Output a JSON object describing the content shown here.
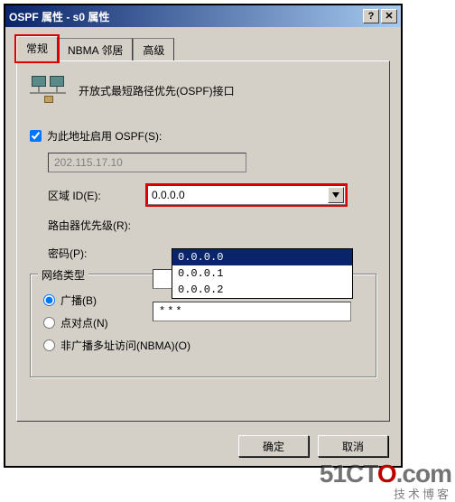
{
  "title": "OSPF 属性 - s0 属性",
  "tabs": {
    "general": "常规",
    "nbma": "NBMA 邻居",
    "advanced": "高级"
  },
  "header": "开放式最短路径优先(OSPF)接口",
  "enable_label": "为此地址启用 OSPF(S):",
  "enable_checked": true,
  "ip_value": "202.115.17.10",
  "area_label": "区域 ID(E):",
  "area_value": "0.0.0.0",
  "area_options": [
    "0.0.0.0",
    "0.0.0.1",
    "0.0.0.2"
  ],
  "priority_label": "路由器优先级(R):",
  "priority_value": "",
  "password_label": "密码(P):",
  "password_value": "***",
  "network_type": {
    "legend": "网络类型",
    "broadcast": "广播(B)",
    "ptp": "点对点(N)",
    "nbma": "非广播多址访问(NBMA)(O)",
    "selected": "broadcast"
  },
  "buttons": {
    "ok": "确定",
    "cancel": "取消"
  },
  "watermark": {
    "brand_pre": "51CT",
    "brand_o": "O",
    "brand_post": ".com",
    "sub": "技术博客"
  }
}
